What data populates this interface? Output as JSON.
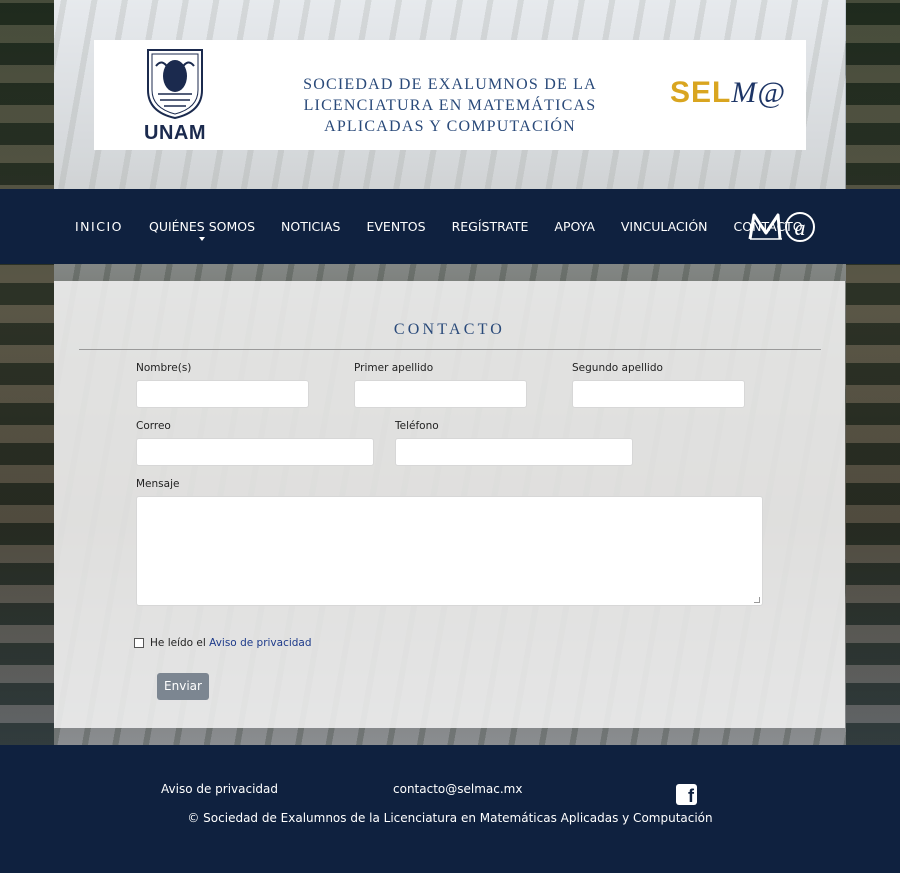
{
  "header": {
    "unam_logo_text": "UNAM",
    "society_title": "SOCIEDAD DE EXALUMNOS DE LA\nLICENCIATURA EN MATEMÁTICAS\nAPLICADAS Y COMPUTACIÓN",
    "selmac_logo_sel": "SEL",
    "selmac_logo_ma": "M@"
  },
  "nav": {
    "items": [
      {
        "label": "INICIO"
      },
      {
        "label": "QUIÉNES SOMOS"
      },
      {
        "label": "NOTICIAS"
      },
      {
        "label": "EVENTOS"
      },
      {
        "label": "REGÍSTRATE"
      },
      {
        "label": "APOYA"
      },
      {
        "label": "VINCULACIÓN"
      },
      {
        "label": "CONTACTO"
      }
    ],
    "logo_text": "M@"
  },
  "contact": {
    "title": "CONTACTO",
    "fields": {
      "nombre": {
        "label": "Nombre(s)",
        "value": ""
      },
      "primer_apellido": {
        "label": "Primer apellido",
        "value": ""
      },
      "segundo_apellido": {
        "label": "Segundo apellido",
        "value": ""
      },
      "correo": {
        "label": "Correo",
        "value": ""
      },
      "telefono": {
        "label": "Teléfono",
        "value": ""
      },
      "mensaje": {
        "label": "Mensaje",
        "value": ""
      }
    },
    "privacy_prefix": "He leído el",
    "privacy_link": "Aviso de privacidad",
    "privacy_checked": false,
    "send_label": "Enviar"
  },
  "footer": {
    "privacy_link": "Aviso de privacidad",
    "email": "contacto@selmac.mx",
    "facebook_icon": "facebook-icon",
    "copyright": "© Sociedad de Exalumnos de la Licenciatura en Matemáticas Aplicadas y Computación"
  },
  "colors": {
    "navy": "#0f213f",
    "title_blue": "#2a4a7a",
    "gold": "#d9a520",
    "button_gray": "#7c8691"
  }
}
